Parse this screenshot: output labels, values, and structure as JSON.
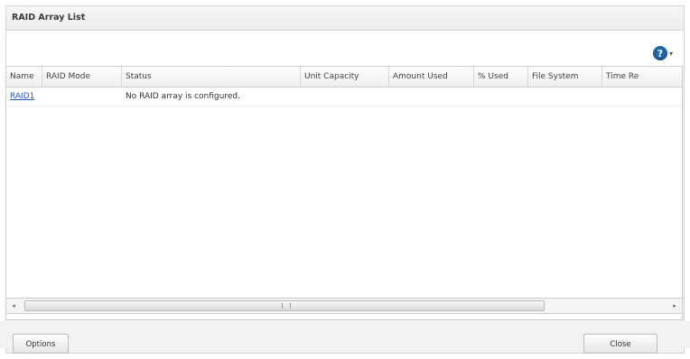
{
  "dialog": {
    "title": "RAID Array List"
  },
  "toolbar": {
    "help_icon": "help-icon",
    "help_glyph": "?",
    "chevron_glyph": "▾"
  },
  "grid": {
    "columns": [
      "Name",
      "RAID Mode",
      "Status",
      "Unit Capacity",
      "Amount Used",
      "% Used",
      "File System",
      "Time Re"
    ],
    "rows": [
      {
        "name": "RAID1",
        "raid_mode": "",
        "status": "No RAID array is configured.",
        "unit_capacity": "",
        "amount_used": "",
        "percent_used": "",
        "file_system": "",
        "time_remaining": ""
      }
    ]
  },
  "scrollbar": {
    "left_arrow": "◂",
    "right_arrow": "▸"
  },
  "footer": {
    "options_label": "Options",
    "close_label": "Close"
  },
  "colors": {
    "link": "#2255cc",
    "help_icon": "#1f66a8"
  }
}
